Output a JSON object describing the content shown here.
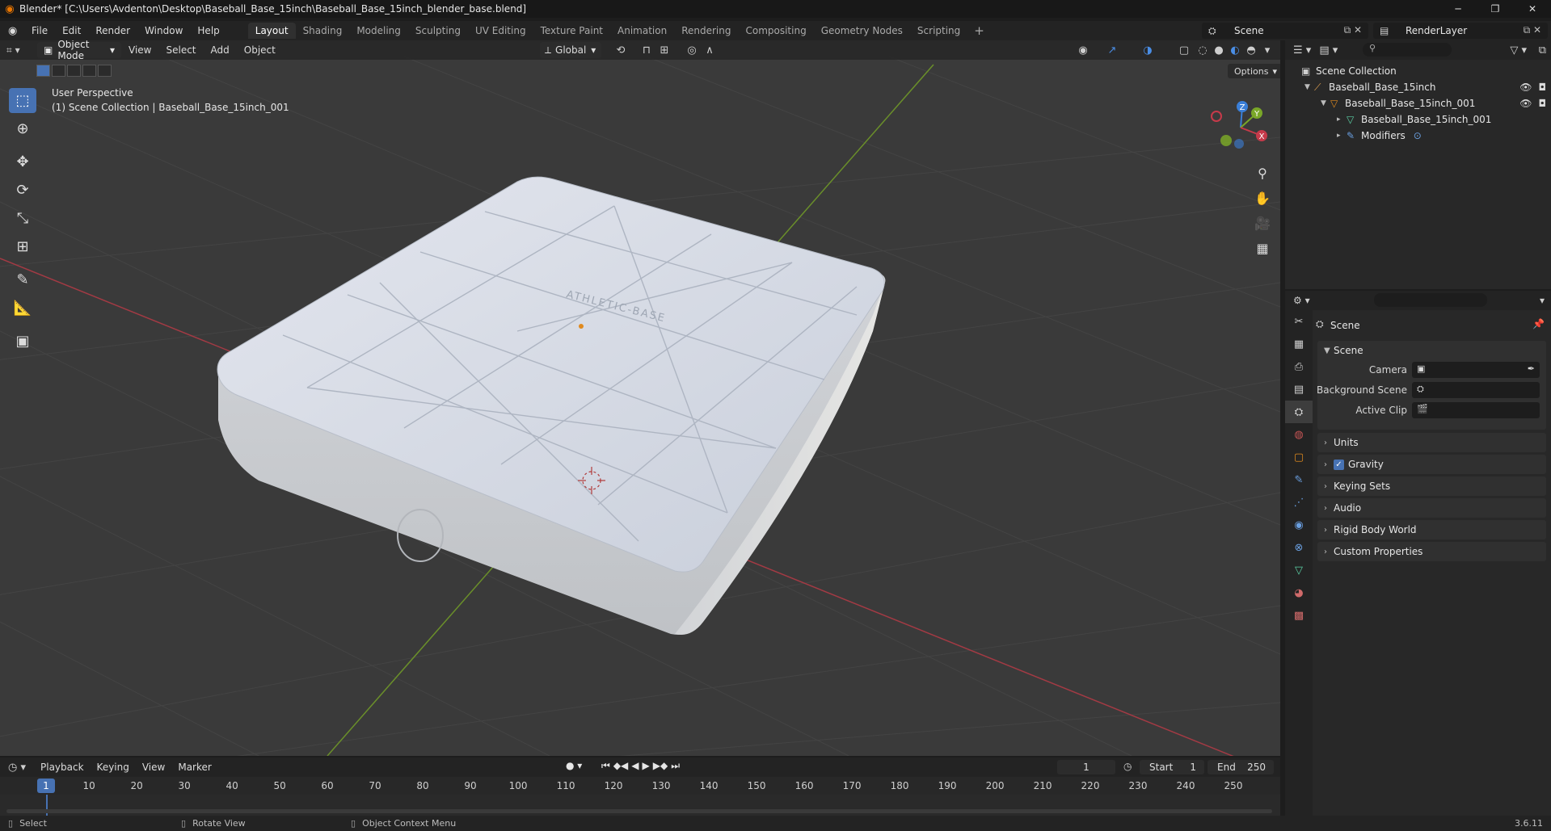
{
  "window": {
    "title": "Blender* [C:\\Users\\Avdenton\\Desktop\\Baseball_Base_15inch\\Baseball_Base_15inch_blender_base.blend]",
    "minimize": "─",
    "maximize": "❐",
    "close": "✕"
  },
  "menubar": {
    "menus": [
      "File",
      "Edit",
      "Render",
      "Window",
      "Help"
    ],
    "workspaces": [
      "Layout",
      "Shading",
      "Modeling",
      "Sculpting",
      "UV Editing",
      "Texture Paint",
      "Animation",
      "Rendering",
      "Compositing",
      "Geometry Nodes",
      "Scripting"
    ],
    "active_workspace": "Layout",
    "add_workspace": "+",
    "scene_name": "Scene",
    "view_layer": "RenderLayer"
  },
  "viewport": {
    "mode": "Object Mode",
    "menus": [
      "View",
      "Select",
      "Add",
      "Object"
    ],
    "transform_orientation": "Global",
    "options_label": "Options",
    "info_line1": "User Perspective",
    "info_line2": "(1) Scene Collection | Baseball_Base_15inch_001",
    "model_logo_text": "ATHLETIC-BASE",
    "gizmo": {
      "x": "X",
      "y": "Y",
      "z": "Z"
    },
    "colors": {
      "x_axis": "#c63a4a",
      "y_axis": "#7aa728",
      "z_axis": "#3a7fd8",
      "active": "#4772b3"
    }
  },
  "outliner": {
    "root": "Scene Collection",
    "items": [
      {
        "label": "Baseball_Base_15inch",
        "icon": "armature-icon"
      },
      {
        "label": "Baseball_Base_15inch_001",
        "icon": "object-icon"
      },
      {
        "label": "Baseball_Base_15inch_001",
        "icon": "mesh-data-icon"
      },
      {
        "label": "Modifiers",
        "icon": "wrench-icon"
      }
    ]
  },
  "properties": {
    "context_title": "Scene",
    "scene_panel": "Scene",
    "fields": [
      {
        "label": "Camera",
        "value": ""
      },
      {
        "label": "Background Scene",
        "value": ""
      },
      {
        "label": "Active Clip",
        "value": ""
      }
    ],
    "panels": [
      "Units",
      "Gravity",
      "Keying Sets",
      "Audio",
      "Rigid Body World",
      "Custom Properties"
    ],
    "gravity_checked": "✓"
  },
  "timeline": {
    "menus": [
      "Playback",
      "Keying",
      "View",
      "Marker"
    ],
    "current_frame": "1",
    "start_label": "Start",
    "start": "1",
    "end_label": "End",
    "end": "250",
    "ruler": [
      "1",
      "10",
      "20",
      "30",
      "40",
      "50",
      "60",
      "70",
      "80",
      "90",
      "100",
      "110",
      "120",
      "130",
      "140",
      "150",
      "160",
      "170",
      "180",
      "190",
      "200",
      "210",
      "220",
      "230",
      "240",
      "250"
    ]
  },
  "statusbar": {
    "hints": [
      "Select",
      "Rotate View",
      "Object Context Menu"
    ],
    "version": "3.6.11"
  }
}
